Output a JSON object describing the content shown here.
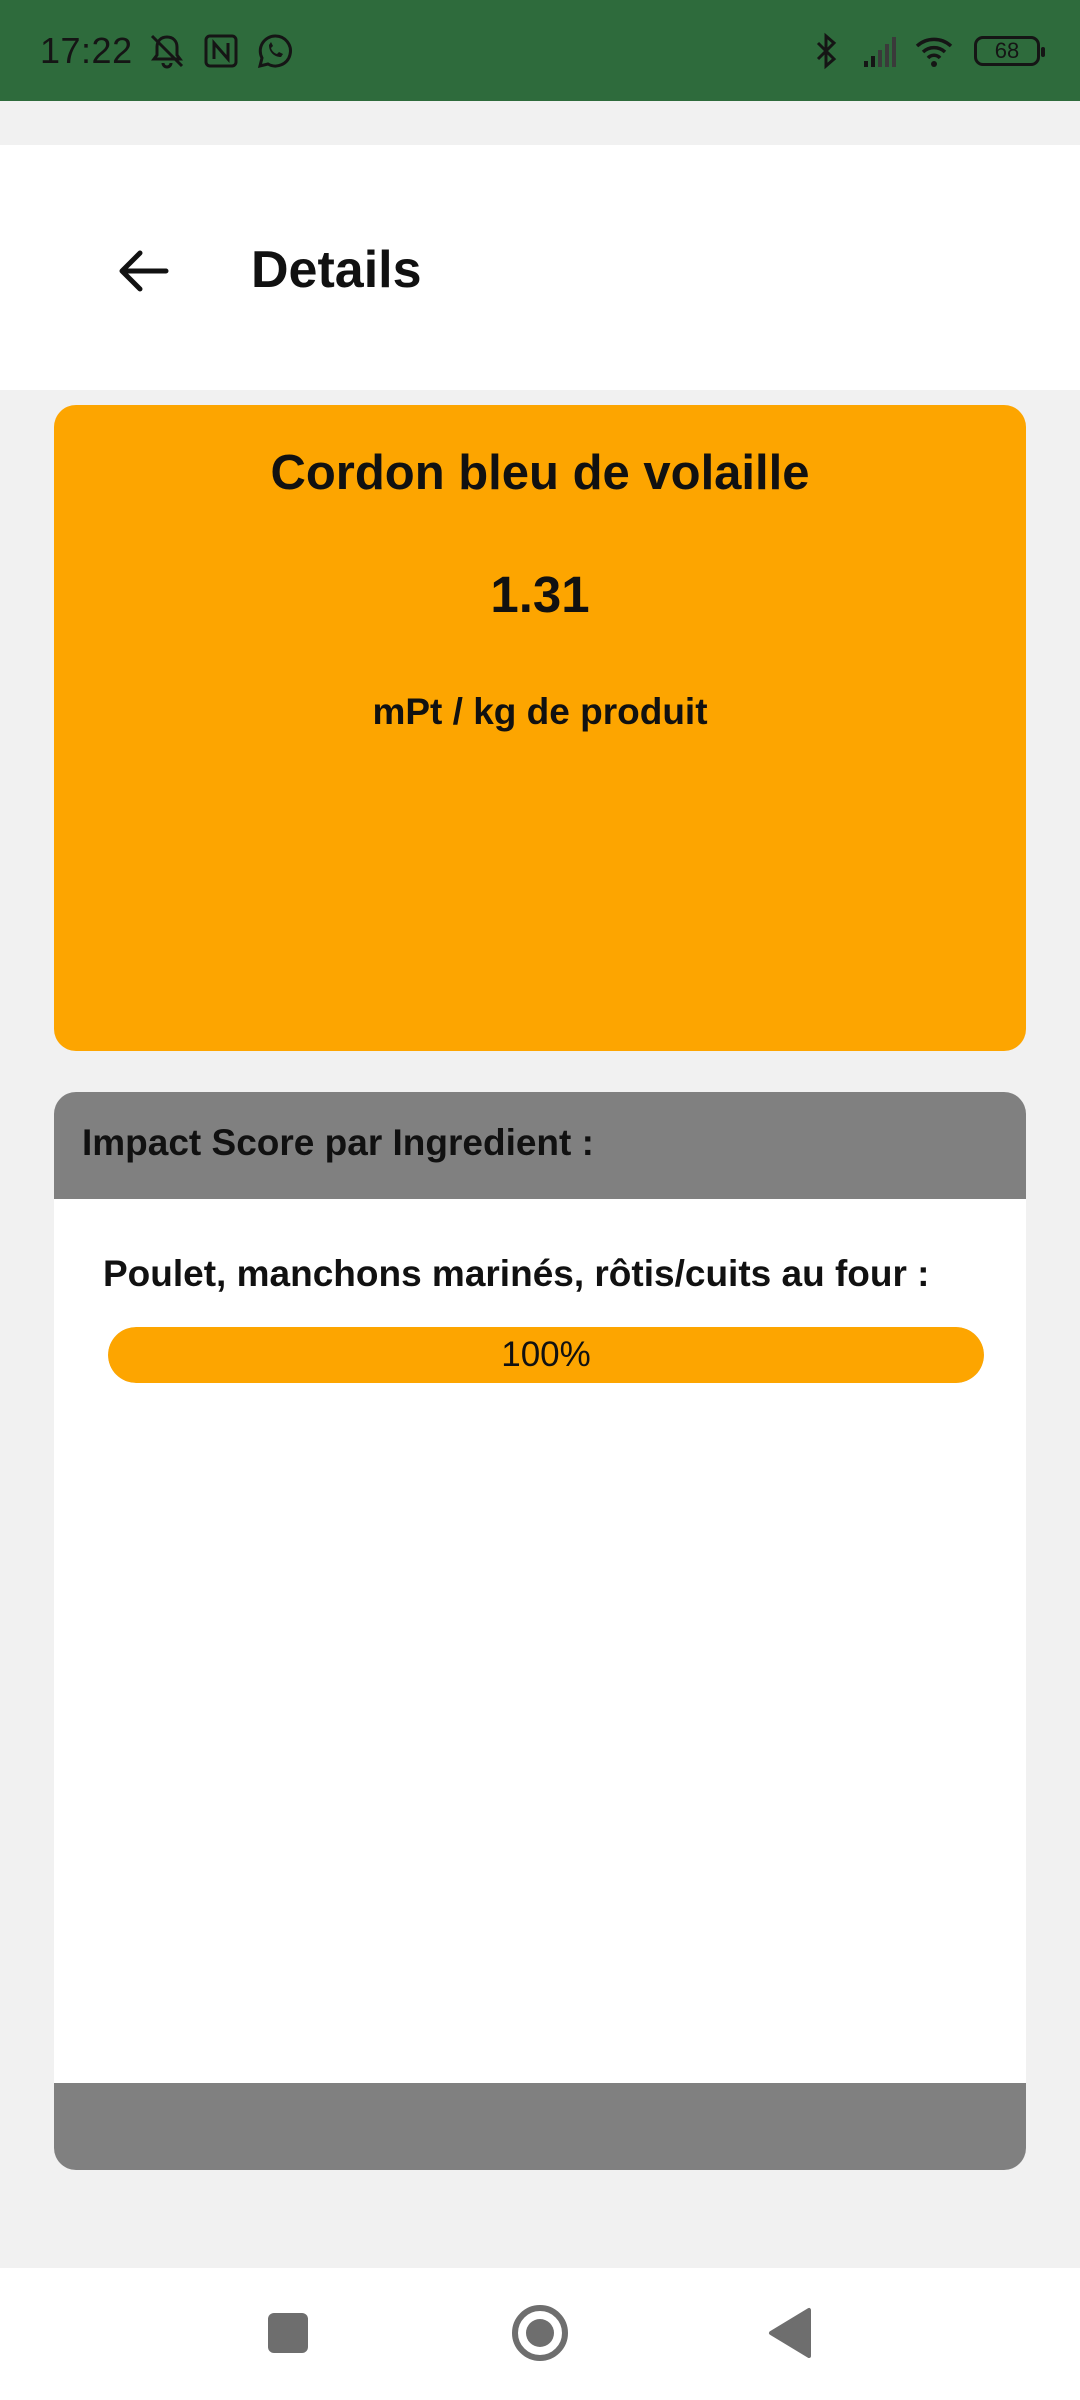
{
  "status_bar": {
    "time": "17:22",
    "battery": "68",
    "icons": [
      "mute-icon",
      "nfc-icon",
      "whatsapp-icon",
      "bluetooth-icon",
      "signal-icon",
      "wifi-icon",
      "battery-icon"
    ]
  },
  "header": {
    "title": "Details",
    "back_icon": "arrow-left-icon"
  },
  "product": {
    "name": "Cordon bleu de volaille",
    "score": "1.31",
    "unit": "mPt / kg de produit",
    "color": "#fda500"
  },
  "impact": {
    "title": "Impact Score par Ingredient :",
    "ingredients": [
      {
        "label": "Poulet, manchons marinés, rôtis/cuits au four :",
        "percent_label": "100%",
        "percent": 100
      }
    ]
  },
  "colors": {
    "status_bar": "#2e6b3c",
    "accent": "#fda500",
    "panel_header": "#808080"
  },
  "nav_bar": {
    "buttons": [
      "recents-icon",
      "home-icon",
      "back-icon"
    ]
  }
}
